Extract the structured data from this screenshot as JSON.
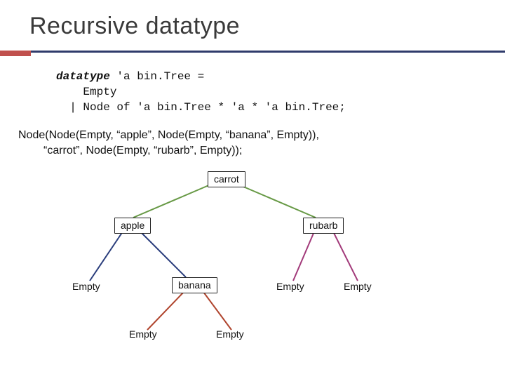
{
  "title": "Recursive datatype",
  "datatype": {
    "line1_kw": "datatype",
    "line1_rest": " 'a bin.Tree =",
    "line2": "    Empty",
    "line3": "  | Node of 'a bin.Tree * 'a * 'a bin.Tree;"
  },
  "code": {
    "line1": "Node(Node(Empty, “apple”, Node(Empty, “banana”, Empty)),",
    "line2": "“carrot”, Node(Empty, “rubarb”, Empty));"
  },
  "tree": {
    "root": "carrot",
    "left": "apple",
    "right": "rubarb",
    "left_left": "Empty",
    "left_right": "banana",
    "left_right_left": "Empty",
    "left_right_right": "Empty",
    "right_left": "Empty",
    "right_right": "Empty"
  },
  "colors": {
    "carrot_edges": "#679945",
    "apple_edges": "#2a3d7c",
    "banana_edges": "#b0452e",
    "rubarb_edges": "#a23a7a"
  }
}
